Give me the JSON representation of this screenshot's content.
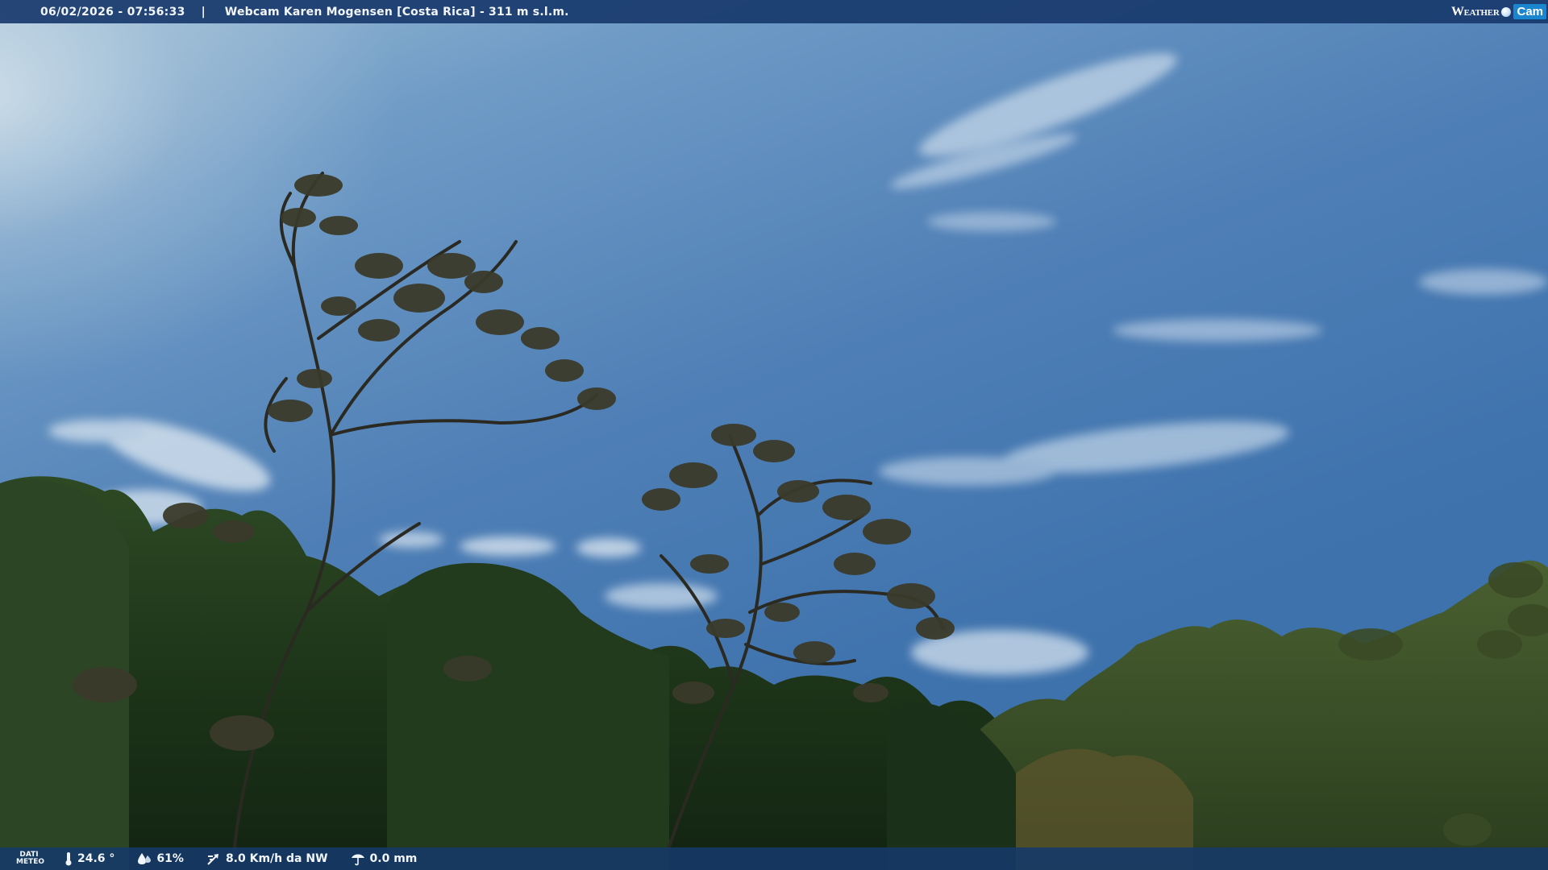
{
  "top_bar": {
    "datetime": "06/02/2026 - 07:56:33",
    "separator": "|",
    "title": "Webcam Karen Mogensen [Costa Rica]  - 311 m s.l.m."
  },
  "brand": {
    "weather": "Weather",
    "cam": "Cam"
  },
  "bottom_bar": {
    "dati_line1": "DATI",
    "dati_line2": "METEO",
    "temperature": "24.6 °",
    "humidity": "61%",
    "wind": "8.0 Km/h da NW",
    "rain": "0.0 mm"
  },
  "colors": {
    "bar_bg": "#183a6c",
    "brand_cam": "#1a86d0",
    "sky": "#3f73ad",
    "foliage": "#1f3a1c"
  },
  "icons": [
    "thermometer-icon",
    "humidity-drop-icon",
    "wind-icon",
    "rain-icon"
  ]
}
